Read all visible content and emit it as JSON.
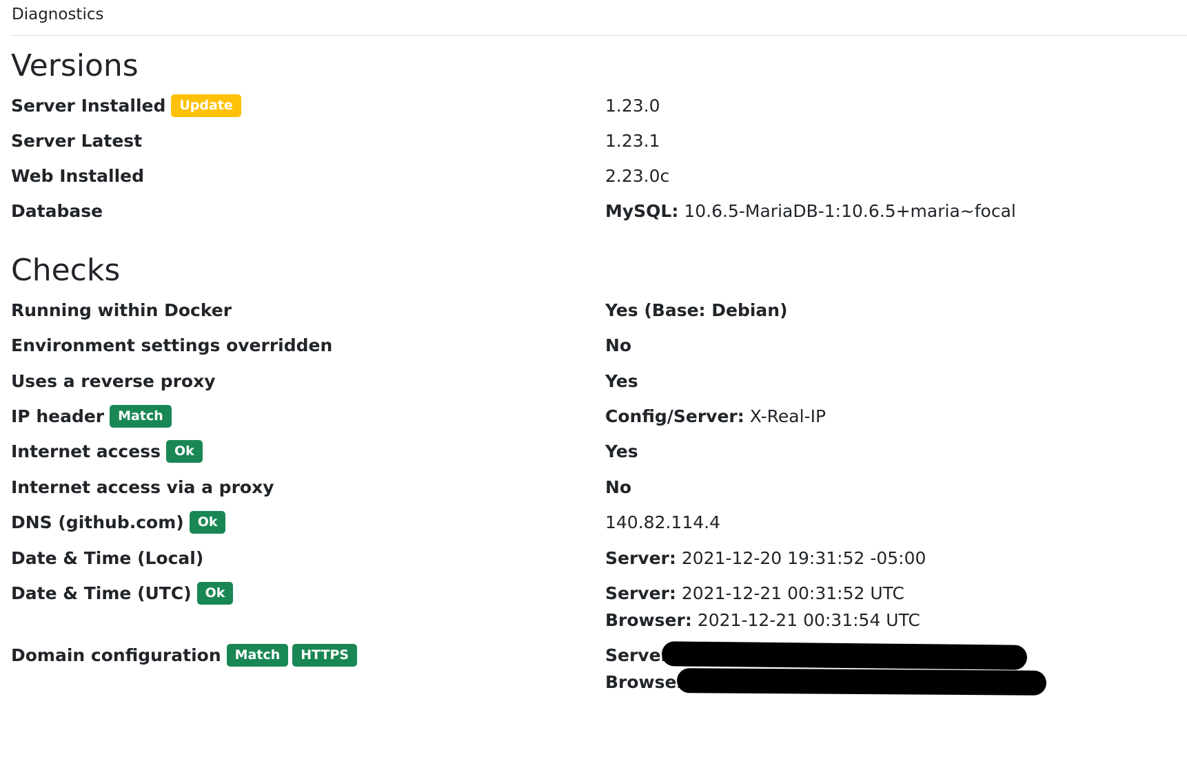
{
  "breadcrumb": "Diagnostics",
  "colors": {
    "badge_success": "#198754",
    "badge_warning": "#ffc107",
    "redaction": "#000000"
  },
  "versions": {
    "title": "Versions",
    "rows": [
      {
        "label": "Server Installed",
        "badge": "Update",
        "value": "1.23.0"
      },
      {
        "label": "Server Latest",
        "value": "1.23.1"
      },
      {
        "label": "Web Installed",
        "value": "2.23.0c"
      },
      {
        "label": "Database",
        "value_key": "MySQL:",
        "value": "10.6.5-MariaDB-1:10.6.5+maria~focal"
      }
    ]
  },
  "checks": {
    "title": "Checks",
    "rows": [
      {
        "label": "Running within Docker",
        "value": "Yes (Base: Debian)"
      },
      {
        "label": "Environment settings overridden",
        "value": "No"
      },
      {
        "label": "Uses a reverse proxy",
        "value": "Yes"
      },
      {
        "label": "IP header",
        "badge": "Match",
        "value_key": "Config/Server:",
        "value": "X-Real-IP"
      },
      {
        "label": "Internet access",
        "badge": "Ok",
        "value": "Yes"
      },
      {
        "label": "Internet access via a proxy",
        "value": "No"
      },
      {
        "label": "DNS (github.com)",
        "badge": "Ok",
        "value": "140.82.114.4"
      },
      {
        "label": "Date & Time (Local)",
        "value_key": "Server:",
        "value": "2021-12-20 19:31:52 -05:00"
      },
      {
        "label": "Date & Time (UTC)",
        "badge": "Ok",
        "value_key": "Server:",
        "value": "2021-12-21 00:31:52 UTC",
        "value2_key": "Browser:",
        "value2": "2021-12-21 00:31:54 UTC"
      },
      {
        "label": "Domain configuration",
        "badges": [
          "Match",
          "HTTPS"
        ],
        "value_key": "Server:",
        "value2_key": "Browser:"
      }
    ]
  }
}
